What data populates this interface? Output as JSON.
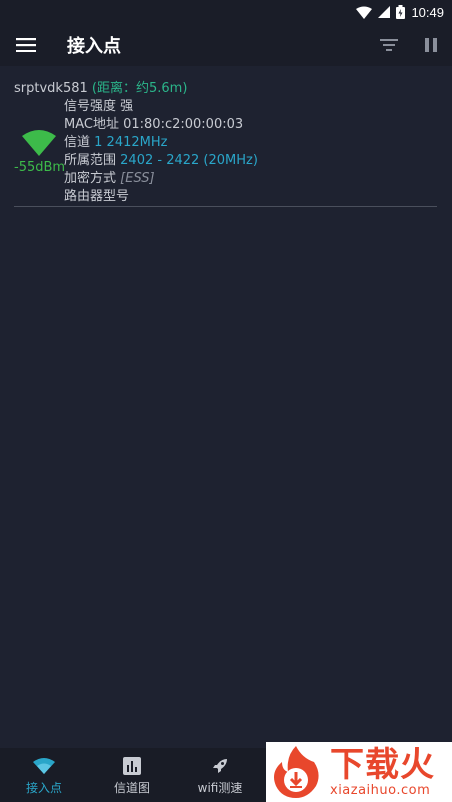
{
  "status_bar": {
    "time": "10:49"
  },
  "app_bar": {
    "title": "接入点",
    "menu_icon": "hamburger-menu-icon",
    "filter_icon": "filter-icon",
    "pause_icon": "pause-icon"
  },
  "access_points": [
    {
      "ssid": "srptvdk581",
      "distance": "(距离：约5.6m)",
      "dbm": "-55dBm",
      "signal_strength_label": "信号强度",
      "signal_strength_value": "强",
      "mac_label": "MAC地址",
      "mac_value": "01:80:c2:00:00:03",
      "channel_label": "信道",
      "channel_value": "1 2412MHz",
      "range_label": "所属范围",
      "range_value": "2402 - 2422 (20MHz)",
      "encryption_label": "加密方式",
      "encryption_value": "[ESS]",
      "router_model_label": "路由器型号",
      "router_model_value": ""
    }
  ],
  "bottom_nav": {
    "items": [
      {
        "label": "接入点",
        "icon": "wifi-icon",
        "active": true
      },
      {
        "label": "信道图",
        "icon": "bar-chart-icon",
        "active": false
      },
      {
        "label": "wifi测速",
        "icon": "rocket-icon",
        "active": false
      }
    ]
  },
  "ad_banner": {
    "brand_cn": "下载火",
    "brand_en": "xiazaihuo.com"
  },
  "colors": {
    "background": "#1e2230",
    "accent": "#2aa6c9",
    "signal_green": "#3dbb4a",
    "distance_green": "#2bb58a",
    "ad_red": "#e8472c"
  }
}
